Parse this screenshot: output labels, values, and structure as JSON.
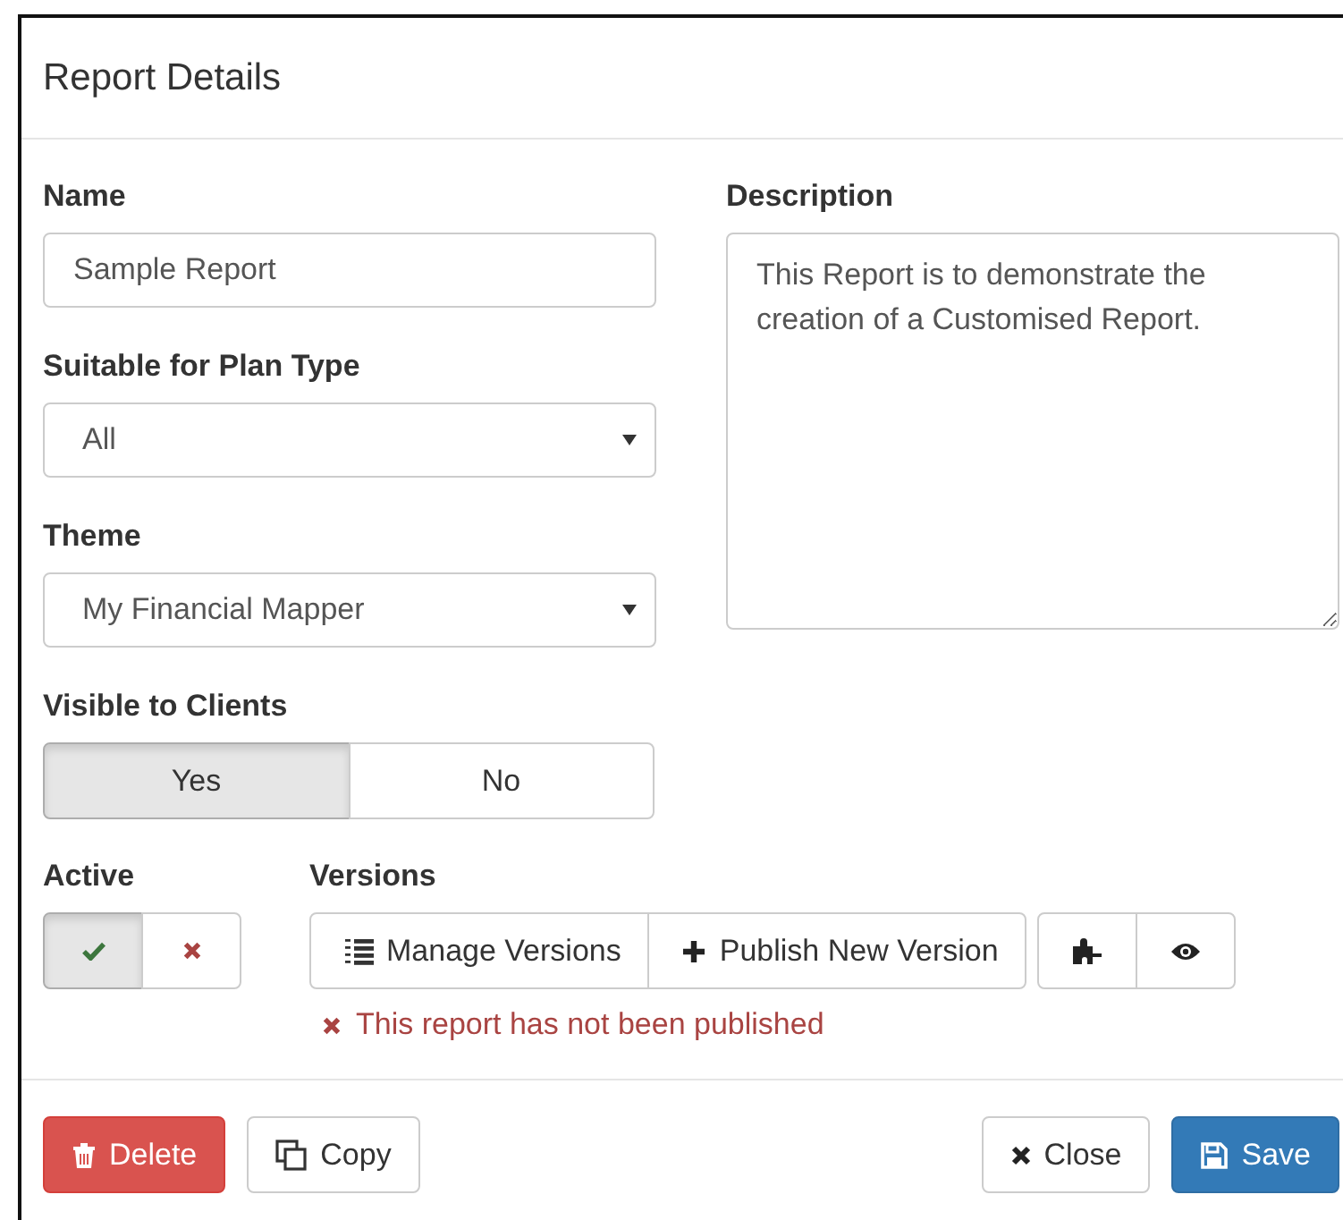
{
  "modal": {
    "title": "Report Details"
  },
  "name": {
    "label": "Name",
    "value": "Sample Report"
  },
  "description": {
    "label": "Description",
    "value": "This Report is to demonstrate the creation of a Customised Report."
  },
  "plan_type": {
    "label": "Suitable for Plan Type",
    "value": "All"
  },
  "theme": {
    "label": "Theme",
    "value": "My Financial Mapper"
  },
  "visible": {
    "label": "Visible to Clients",
    "options": [
      {
        "label": "Yes",
        "selected": true
      },
      {
        "label": "No",
        "selected": false
      }
    ]
  },
  "active": {
    "label": "Active",
    "options": [
      {
        "kind": "check",
        "selected": true
      },
      {
        "kind": "cross",
        "selected": false
      }
    ]
  },
  "versions": {
    "label": "Versions",
    "buttons": [
      {
        "label": "Manage Versions"
      },
      {
        "label": "Publish New Version"
      }
    ],
    "tools": [
      {
        "kind": "puzzle"
      },
      {
        "kind": "eye"
      }
    ],
    "status": {
      "text": "This report has not been published",
      "published": false
    }
  },
  "footer": {
    "buttons": [
      {
        "label": "Delete",
        "kind": "danger"
      },
      {
        "label": "Copy",
        "kind": "default"
      },
      {
        "label": "Close",
        "kind": "default"
      },
      {
        "label": "Save",
        "kind": "primary"
      }
    ]
  }
}
